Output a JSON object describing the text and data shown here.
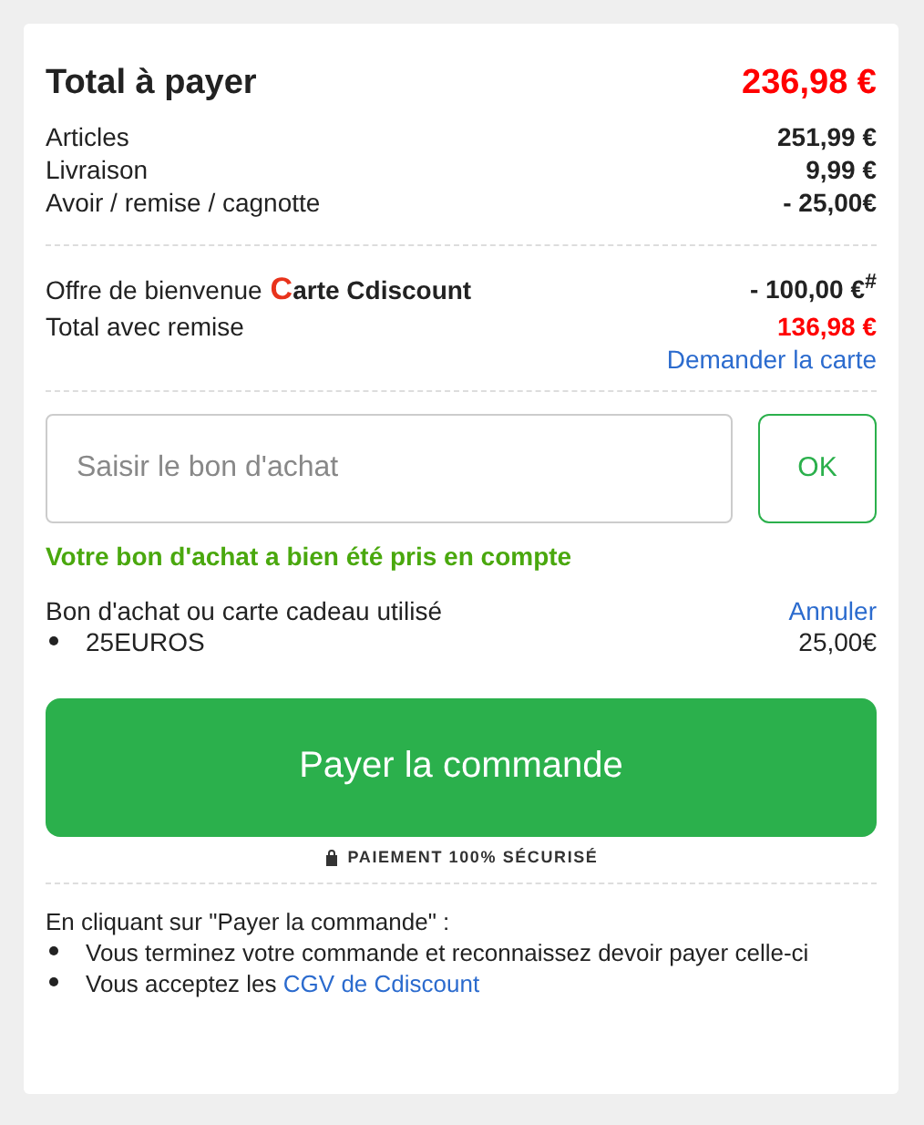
{
  "summary": {
    "title": "Total à payer",
    "total": "236,98 €",
    "lines": [
      {
        "label": "Articles",
        "value": "251,99 €"
      },
      {
        "label": "Livraison",
        "value": "9,99 €"
      },
      {
        "label": "Avoir / remise / cagnotte",
        "value": "- 25,00€"
      }
    ]
  },
  "offer": {
    "label": "Offre de bienvenue",
    "brand_initial": "C",
    "brand_rest": "arte Cdiscount",
    "value": "- 100,00 €$^{#}$",
    "total_label": "Total avec remise",
    "total_value": "136,98 €",
    "link": "Demander la carte"
  },
  "voucher": {
    "placeholder": "Saisir le bon d'achat",
    "button": "OK",
    "success": "Votre bon d'achat a bien été pris en compte",
    "used_label": "Bon d'achat ou carte cadeau utilisé",
    "cancel": "Annuler",
    "items": [
      {
        "code": "25EUROS",
        "amount": "25,00€"
      }
    ]
  },
  "pay": {
    "button": "Payer la commande",
    "secure": "PAIEMENT 100% SÉCURISÉ"
  },
  "terms": {
    "intro": "En cliquant sur \"Payer la commande\" :",
    "items": [
      {
        "text": "Vous terminez votre commande et reconnaissez devoir payer celle-ci"
      },
      {
        "text": "Vous acceptez les",
        "link": "CGV de Cdiscount"
      }
    ]
  }
}
